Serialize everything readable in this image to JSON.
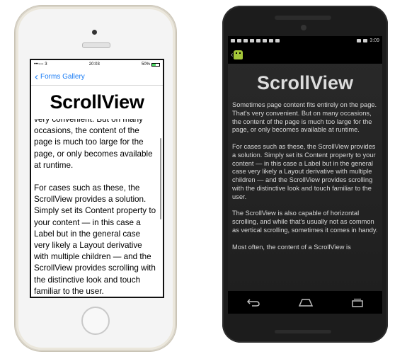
{
  "ios": {
    "status": {
      "carrier": "•••○○ 3",
      "time": "20:03",
      "battery": "50%"
    },
    "nav": {
      "back_label": "Forms Gallery"
    },
    "title": "ScrollView",
    "paragraphs": [
      "very convenient. But on many occasions, the content of the page is much too large for the page, or only becomes available at runtime.",
      "For cases such as these, the ScrollView provides a solution. Simply set its Content property to your content — in this case a Label but in the general case very likely a Layout derivative with multiple children — and the ScrollView provides scrolling with the distinctive look and touch familiar to the user."
    ]
  },
  "android": {
    "status": {
      "time": "3:09"
    },
    "title": "ScrollView",
    "paragraphs": [
      "Sometimes page content fits entirely on the page. That's very convenient. But on many occasions, the content of the page is much too large for the page, or only becomes available at runtime.",
      "For cases such as these, the ScrollView provides a solution. Simply set its Content property to your content — in this case a Label but in the general case very likely a Layout derivative with multiple children — and the ScrollView provides scrolling with the distinctive look and touch familiar to the user.",
      "The ScrollView is also capable of horizontal scrolling, and while that's usually not as common as vertical scrolling, sometimes it comes in handy.",
      "Most often, the content of a ScrollView is"
    ],
    "navbar": [
      "back-icon",
      "home-icon",
      "recents-icon"
    ]
  },
  "colors": {
    "ios_accent": "#1a7cf5",
    "android_logo": "#a4c639"
  }
}
